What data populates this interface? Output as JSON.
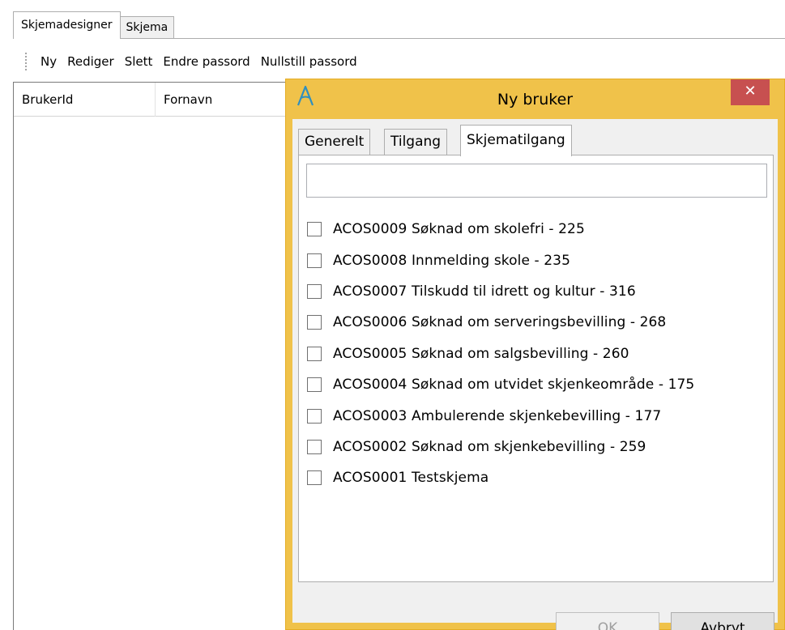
{
  "app": {
    "tabs": [
      {
        "label": "Skjemadesigner",
        "active": true
      },
      {
        "label": "Skjema",
        "active": false
      }
    ],
    "toolbar": {
      "buttons": [
        "Ny",
        "Rediger",
        "Slett",
        "Endre passord",
        "Nullstill passord"
      ]
    },
    "grid": {
      "columns": [
        "BrukerId",
        "Fornavn"
      ]
    }
  },
  "dialog": {
    "title": "Ny bruker",
    "close_glyph": "✕",
    "tabs": [
      {
        "label": "Generelt",
        "selected": false
      },
      {
        "label": "Tilgang",
        "selected": false
      },
      {
        "label": "Skjematilgang",
        "selected": true
      }
    ],
    "search": {
      "value": "",
      "placeholder": ""
    },
    "forms": [
      {
        "label": "ACOS0009 Søknad om skolefri - 225",
        "checked": false
      },
      {
        "label": "ACOS0008 Innmelding skole - 235",
        "checked": false
      },
      {
        "label": "ACOS0007 Tilskudd til idrett og kultur - 316",
        "checked": false
      },
      {
        "label": "ACOS0006 Søknad om serveringsbevilling - 268",
        "checked": false
      },
      {
        "label": "ACOS0005 Søknad om salgsbevilling - 260",
        "checked": false
      },
      {
        "label": "ACOS0004 Søknad om utvidet skjenkeområde - 175",
        "checked": false
      },
      {
        "label": "ACOS0003 Ambulerende skjenkebevilling - 177",
        "checked": false
      },
      {
        "label": "ACOS0002 Søknad om skjenkebevilling - 259",
        "checked": false
      },
      {
        "label": "ACOS0001 Testskjema",
        "checked": false
      }
    ],
    "buttons": {
      "ok": "OK",
      "cancel": "Avbryt",
      "ok_enabled": false
    }
  },
  "colors": {
    "dialog_frame": "#f0c24a",
    "close_button": "#c75050",
    "logo": "#2f8fbf"
  },
  "icons": {
    "logo": "acos-a-logo-icon",
    "close": "close-icon",
    "toolbar_grip": "grip-icon"
  }
}
